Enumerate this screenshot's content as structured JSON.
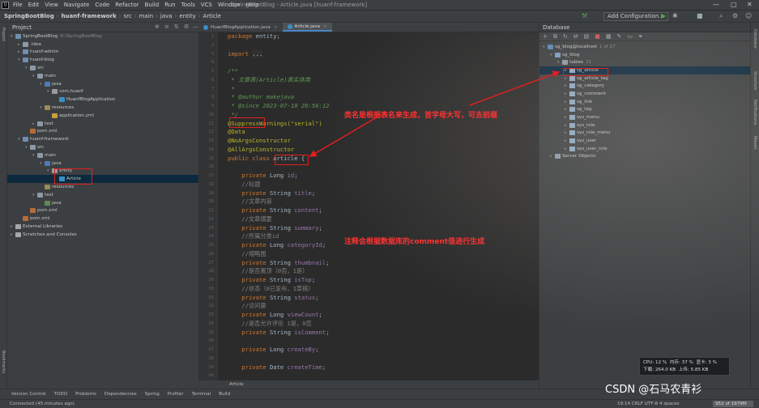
{
  "menu": {
    "items": [
      "File",
      "Edit",
      "View",
      "Navigate",
      "Code",
      "Refactor",
      "Build",
      "Run",
      "Tools",
      "VCS",
      "Window",
      "Help"
    ],
    "window_title": "SpringBootBlog - Article.java [huanf-framework]"
  },
  "navbar": {
    "crumbs": [
      "SpringBootBlog",
      "huanf-framework",
      "src",
      "main",
      "java",
      "entity",
      "Article"
    ],
    "add_config": "Add Configuration..."
  },
  "left_strip": {
    "project": "Project",
    "bookmarks": "Bookmarks"
  },
  "right_strip": {
    "database": "Database",
    "structure": "Structure",
    "notifications": "Notifications",
    "maven": "Maven"
  },
  "project": {
    "title": "Project",
    "tree": [
      {
        "label": "SpringBootBlog",
        "extra": "D:\\SpringBootBlog",
        "icon": "module",
        "depth": 0,
        "arrow": "▾"
      },
      {
        "label": ".idea",
        "icon": "folder",
        "depth": 1,
        "arrow": "▸"
      },
      {
        "label": "huanf-admin",
        "icon": "module",
        "depth": 1,
        "arrow": "▸"
      },
      {
        "label": "huanf-blog",
        "icon": "module",
        "depth": 1,
        "arrow": "▾"
      },
      {
        "label": "src",
        "icon": "folder",
        "depth": 2,
        "arrow": "▾"
      },
      {
        "label": "main",
        "icon": "folder",
        "depth": 3,
        "arrow": "▾"
      },
      {
        "label": "java",
        "icon": "src",
        "depth": 4,
        "arrow": "▾"
      },
      {
        "label": "com.huanf",
        "icon": "pkg",
        "depth": 5,
        "arrow": "▾"
      },
      {
        "label": "HuanfBlogApplication",
        "icon": "cls",
        "depth": 6,
        "arrow": ""
      },
      {
        "label": "resources",
        "icon": "res",
        "depth": 4,
        "arrow": "▾"
      },
      {
        "label": "application.yml",
        "icon": "yml",
        "depth": 5,
        "arrow": ""
      },
      {
        "label": "test",
        "icon": "folder",
        "depth": 3,
        "arrow": "▸"
      },
      {
        "label": "pom.xml",
        "icon": "xml",
        "depth": 2,
        "arrow": ""
      },
      {
        "label": "huanf-framework",
        "icon": "module",
        "depth": 1,
        "arrow": "▾"
      },
      {
        "label": "src",
        "icon": "folder",
        "depth": 2,
        "arrow": "▾"
      },
      {
        "label": "main",
        "icon": "folder",
        "depth": 3,
        "arrow": "▾"
      },
      {
        "label": "java",
        "icon": "src",
        "depth": 4,
        "arrow": "▾"
      },
      {
        "label": "entity",
        "icon": "pkg",
        "depth": 5,
        "arrow": "▾"
      },
      {
        "label": "Article",
        "icon": "cls",
        "depth": 6,
        "arrow": "",
        "selected": true
      },
      {
        "label": "resources",
        "icon": "res",
        "depth": 4,
        "arrow": ""
      },
      {
        "label": "test",
        "icon": "folder",
        "depth": 3,
        "arrow": "▾"
      },
      {
        "label": "java",
        "icon": "test",
        "depth": 4,
        "arrow": ""
      },
      {
        "label": "pom.xml",
        "icon": "xml",
        "depth": 2,
        "arrow": ""
      },
      {
        "label": "pom.xml",
        "icon": "xml",
        "depth": 1,
        "arrow": ""
      },
      {
        "label": "External Libraries",
        "icon": "lib",
        "depth": 0,
        "arrow": "▸"
      },
      {
        "label": "Scratches and Consoles",
        "icon": "lib",
        "depth": 0,
        "arrow": "▸"
      }
    ]
  },
  "editor": {
    "tabs": [
      {
        "label": "HuanfBlogApplication.java",
        "active": false
      },
      {
        "label": "Article.java",
        "active": true
      }
    ],
    "line_numbers": [
      1,
      2,
      3,
      4,
      5,
      6,
      7,
      8,
      9,
      10,
      11,
      12,
      13,
      14,
      15,
      16,
      17,
      18,
      19,
      20,
      21,
      22,
      23,
      24,
      25,
      26,
      27,
      28,
      29,
      30,
      31,
      32,
      33,
      34,
      35,
      36,
      37,
      38,
      39,
      40
    ],
    "lines": [
      [
        {
          "t": "package ",
          "c": "kw"
        },
        {
          "t": "entity;",
          "c": ""
        }
      ],
      [],
      [
        {
          "t": "import ",
          "c": "kw"
        },
        {
          "t": "...",
          "c": "hl"
        }
      ],
      [],
      [
        {
          "t": "/**",
          "c": "cm"
        }
      ],
      [
        {
          "t": " * 文章表(Article)表实体类",
          "c": "cm"
        }
      ],
      [
        {
          "t": " *",
          "c": "cm"
        }
      ],
      [
        {
          "t": " * @author ",
          "c": "cm"
        },
        {
          "t": "makejava",
          "c": "cm"
        }
      ],
      [
        {
          "t": " * @since ",
          "c": "cm"
        },
        {
          "t": "2023-07-18 20:56:12",
          "c": "cm"
        }
      ],
      [
        {
          "t": " */",
          "c": "cm"
        }
      ],
      [
        {
          "t": "@SuppressWarnings(\"serial\")",
          "c": "ann"
        }
      ],
      [
        {
          "t": "@Data",
          "c": "ann"
        }
      ],
      [
        {
          "t": "@NoArgsConstructor",
          "c": "ann"
        }
      ],
      [
        {
          "t": "@AllArgsConstructor",
          "c": "ann"
        }
      ],
      [
        {
          "t": "public class ",
          "c": "kw"
        },
        {
          "t": "Article",
          "c": ""
        },
        {
          "t": " {",
          "c": ""
        }
      ],
      [],
      [
        {
          "t": "    private ",
          "c": "kw"
        },
        {
          "t": "Long ",
          "c": ""
        },
        {
          "t": "id",
          "c": "fld"
        },
        {
          "t": ";",
          "c": ""
        }
      ],
      [
        {
          "t": "    //标题",
          "c": "cmt"
        }
      ],
      [
        {
          "t": "    private ",
          "c": "kw"
        },
        {
          "t": "String ",
          "c": ""
        },
        {
          "t": "title",
          "c": "fld"
        },
        {
          "t": ";",
          "c": ""
        }
      ],
      [
        {
          "t": "    //文章内容",
          "c": "cmt"
        }
      ],
      [
        {
          "t": "    private ",
          "c": "kw"
        },
        {
          "t": "String ",
          "c": ""
        },
        {
          "t": "content",
          "c": "fld"
        },
        {
          "t": ";",
          "c": ""
        }
      ],
      [
        {
          "t": "    //文章摘要",
          "c": "cmt"
        }
      ],
      [
        {
          "t": "    private ",
          "c": "kw"
        },
        {
          "t": "String ",
          "c": ""
        },
        {
          "t": "summary",
          "c": "fld"
        },
        {
          "t": ";",
          "c": ""
        }
      ],
      [
        {
          "t": "    //所属分类id",
          "c": "cmt"
        }
      ],
      [
        {
          "t": "    private ",
          "c": "kw"
        },
        {
          "t": "Long ",
          "c": ""
        },
        {
          "t": "categoryId",
          "c": "fld"
        },
        {
          "t": ";",
          "c": ""
        }
      ],
      [
        {
          "t": "    //缩略图",
          "c": "cmt"
        }
      ],
      [
        {
          "t": "    private ",
          "c": "kw"
        },
        {
          "t": "String ",
          "c": ""
        },
        {
          "t": "thumbnail",
          "c": "fld"
        },
        {
          "t": ";",
          "c": ""
        }
      ],
      [
        {
          "t": "    //是否置顶（0否，1是）",
          "c": "cmt"
        }
      ],
      [
        {
          "t": "    private ",
          "c": "kw"
        },
        {
          "t": "String ",
          "c": ""
        },
        {
          "t": "isTop",
          "c": "fld"
        },
        {
          "t": ";",
          "c": ""
        }
      ],
      [
        {
          "t": "    //状态（0已发布，1草稿）",
          "c": "cmt"
        }
      ],
      [
        {
          "t": "    private ",
          "c": "kw"
        },
        {
          "t": "String ",
          "c": ""
        },
        {
          "t": "status",
          "c": "fld"
        },
        {
          "t": ";",
          "c": ""
        }
      ],
      [
        {
          "t": "    //访问量",
          "c": "cmt"
        }
      ],
      [
        {
          "t": "    private ",
          "c": "kw"
        },
        {
          "t": "Long ",
          "c": ""
        },
        {
          "t": "viewCount",
          "c": "fld"
        },
        {
          "t": ";",
          "c": ""
        }
      ],
      [
        {
          "t": "    //是否允许评论 1是，0否",
          "c": "cmt"
        }
      ],
      [
        {
          "t": "    private ",
          "c": "kw"
        },
        {
          "t": "String ",
          "c": ""
        },
        {
          "t": "isComment",
          "c": "fld"
        },
        {
          "t": ";",
          "c": ""
        }
      ],
      [],
      [
        {
          "t": "    private ",
          "c": "kw"
        },
        {
          "t": "Long ",
          "c": ""
        },
        {
          "t": "createBy",
          "c": "fld"
        },
        {
          "t": ";",
          "c": ""
        }
      ],
      [],
      [
        {
          "t": "    private ",
          "c": "kw"
        },
        {
          "t": "Date ",
          "c": ""
        },
        {
          "t": "createTime",
          "c": "fld"
        },
        {
          "t": ";",
          "c": ""
        }
      ],
      []
    ],
    "breadcrumb": "Article"
  },
  "database": {
    "title": "Database",
    "tree": [
      {
        "label": "sg_blog@localhost",
        "extra": "1 of 27",
        "icon": "dbs",
        "depth": 0,
        "arrow": "▾"
      },
      {
        "label": "sg_blog",
        "icon": "schema",
        "depth": 1,
        "arrow": "▾"
      },
      {
        "label": "tables",
        "extra": "11",
        "icon": "folder",
        "depth": 2,
        "arrow": "▾"
      },
      {
        "label": "sg_article",
        "icon": "tbl",
        "depth": 3,
        "arrow": "▸",
        "selected": true
      },
      {
        "label": "sg_article_tag",
        "icon": "tbl",
        "depth": 3,
        "arrow": "▸"
      },
      {
        "label": "sg_category",
        "icon": "tbl",
        "depth": 3,
        "arrow": "▸"
      },
      {
        "label": "sg_comment",
        "icon": "tbl",
        "depth": 3,
        "arrow": "▸"
      },
      {
        "label": "sg_link",
        "icon": "tbl",
        "depth": 3,
        "arrow": "▸"
      },
      {
        "label": "sg_tag",
        "icon": "tbl",
        "depth": 3,
        "arrow": "▸"
      },
      {
        "label": "sys_menu",
        "icon": "tbl",
        "depth": 3,
        "arrow": "▸"
      },
      {
        "label": "sys_role",
        "icon": "tbl",
        "depth": 3,
        "arrow": "▸"
      },
      {
        "label": "sys_role_menu",
        "icon": "tbl",
        "depth": 3,
        "arrow": "▸"
      },
      {
        "label": "sys_user",
        "icon": "tbl",
        "depth": 3,
        "arrow": "▸"
      },
      {
        "label": "sys_user_role",
        "icon": "tbl",
        "depth": 3,
        "arrow": "▸"
      },
      {
        "label": "Server Objects",
        "icon": "folder",
        "depth": 1,
        "arrow": "▸"
      }
    ]
  },
  "annotations": {
    "note1": "类名是根据表名来生成，首字母大写，可去前缀",
    "note2": "注释会根据数据库的comment值进行生成",
    "color": "#ff3333"
  },
  "perf": {
    "cpu": "CPU: 12 %",
    "mem": "内存: 37 %",
    "disk": "显卡: 3 %",
    "down": "下载: 264.0 KB",
    "up": "上传: 5.85 KB"
  },
  "toolwindows": [
    "Version Control",
    "TODO",
    "Problems",
    "Dependencies",
    "Spring",
    "Profiler",
    "Terminal",
    "Build"
  ],
  "status": {
    "left": "Connected (45 minutes ago)",
    "right": "19:14   CRLF   UTF-8   4 spaces",
    "memory": "952 of 1979M"
  },
  "watermark": "CSDN @石马农青衫"
}
